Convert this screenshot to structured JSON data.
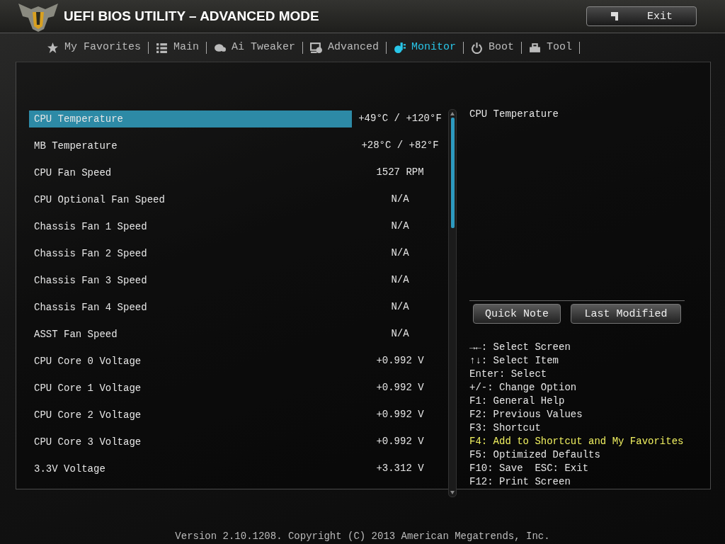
{
  "header": {
    "title": "UEFI BIOS UTILITY – ADVANCED MODE",
    "exit_button": "Exit"
  },
  "tabs": [
    {
      "label": "My Favorites",
      "kind": "star",
      "selected": false
    },
    {
      "label": "Main",
      "kind": "list",
      "selected": false
    },
    {
      "label": "Ai Tweaker",
      "kind": "tweaker",
      "selected": false
    },
    {
      "label": "Advanced",
      "kind": "advanced",
      "selected": false
    },
    {
      "label": "Monitor",
      "kind": "monitor",
      "selected": true
    },
    {
      "label": "Boot",
      "kind": "power",
      "selected": false
    },
    {
      "label": "Tool",
      "kind": "tool",
      "selected": false
    }
  ],
  "items": [
    {
      "name": "CPU Temperature",
      "value": "+49°C / +120°F",
      "selected": true
    },
    {
      "name": "MB Temperature",
      "value": "+28°C / +82°F",
      "selected": false
    },
    {
      "name": "CPU Fan Speed",
      "value": "1527 RPM",
      "selected": false
    },
    {
      "name": "CPU Optional Fan Speed",
      "value": "N/A",
      "selected": false
    },
    {
      "name": "Chassis Fan 1 Speed",
      "value": "N/A",
      "selected": false
    },
    {
      "name": "Chassis Fan 2 Speed",
      "value": "N/A",
      "selected": false
    },
    {
      "name": "Chassis Fan 3 Speed",
      "value": "N/A",
      "selected": false
    },
    {
      "name": "Chassis Fan 4 Speed",
      "value": "N/A",
      "selected": false
    },
    {
      "name": "ASST Fan Speed",
      "value": "N/A",
      "selected": false
    },
    {
      "name": "CPU Core 0 Voltage",
      "value": "+0.992 V",
      "selected": false
    },
    {
      "name": "CPU Core 1 Voltage",
      "value": "+0.992 V",
      "selected": false
    },
    {
      "name": "CPU Core 2 Voltage",
      "value": "+0.992 V",
      "selected": false
    },
    {
      "name": "CPU Core 3 Voltage",
      "value": "+0.992 V",
      "selected": false
    },
    {
      "name": "3.3V Voltage",
      "value": "+3.312 V",
      "selected": false
    }
  ],
  "help_panel": {
    "description": "CPU Temperature",
    "buttons": [
      "Quick Note",
      "Last Modified"
    ],
    "keys": [
      {
        "text": "→←: Select Screen",
        "highlighted": false
      },
      {
        "text": "↑↓: Select Item",
        "highlighted": false
      },
      {
        "text": "Enter: Select",
        "highlighted": false
      },
      {
        "text": "+/-: Change Option",
        "highlighted": false
      },
      {
        "text": "F1: General Help",
        "highlighted": false
      },
      {
        "text": "F2: Previous Values",
        "highlighted": false
      },
      {
        "text": "F3: Shortcut",
        "highlighted": false
      },
      {
        "text": "F4: Add to Shortcut and My Favorites",
        "highlighted": true
      },
      {
        "text": "F5: Optimized Defaults",
        "highlighted": false
      },
      {
        "text": "F10: Save  ESC: Exit",
        "highlighted": false
      },
      {
        "text": "F12: Print Screen",
        "highlighted": false
      }
    ]
  },
  "footer": "Version 2.10.1208. Copyright (C) 2013 American Megatrends, Inc."
}
